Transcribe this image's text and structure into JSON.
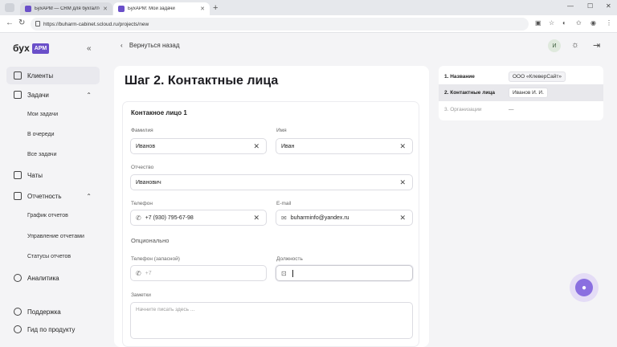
{
  "browser": {
    "tabs": [
      {
        "title": "БухАРМ — CRM для бухгалтер..."
      },
      {
        "title": "БухАРМ: Мои задачи"
      }
    ],
    "url": "https://buharm-cabinet.scloud.ru/projects/new"
  },
  "logo": {
    "text": "бух",
    "badge": "АРМ"
  },
  "sidebar": {
    "items": [
      {
        "label": "Клиенты"
      },
      {
        "label": "Задачи"
      },
      {
        "label": "Чаты"
      },
      {
        "label": "Отчетность"
      },
      {
        "label": "Аналитика"
      },
      {
        "label": "Поддержка"
      },
      {
        "label": "Гид по продукту"
      }
    ],
    "tasks_sub": [
      "Мои задачи",
      "В очереди",
      "Все задачи"
    ],
    "reports_sub": [
      "График отчетов",
      "Управление отчетами",
      "Статусы отчетов"
    ]
  },
  "header": {
    "back_label": "Вернуться назад",
    "avatar_initial": "И"
  },
  "page": {
    "title": "Шаг 2. Контактные лица"
  },
  "contact": {
    "heading": "Контакное лицо 1",
    "last_name": {
      "label": "Фамилия",
      "value": "Иванов"
    },
    "first_name": {
      "label": "Имя",
      "value": "Иван"
    },
    "patronymic": {
      "label": "Отчество",
      "value": "Иванович"
    },
    "phone": {
      "label": "Телефон",
      "value": "+7 (930) 795-67-98"
    },
    "email": {
      "label": "E-mail",
      "value": "buharminfo@yandex.ru"
    },
    "optional_heading": "Опционально",
    "phone_backup": {
      "label": "Телефон (запасной)",
      "placeholder": "+7"
    },
    "position": {
      "label": "Должность",
      "value": ""
    },
    "notes": {
      "label": "Заметки",
      "placeholder": "Начните писать здесь ..."
    }
  },
  "steps": [
    {
      "name": "1. Название",
      "value": "ООО «КлеверСайт»"
    },
    {
      "name": "2. Контактные лица",
      "value": "Иванов И. И."
    },
    {
      "name": "3. Организации",
      "value": "—"
    }
  ]
}
